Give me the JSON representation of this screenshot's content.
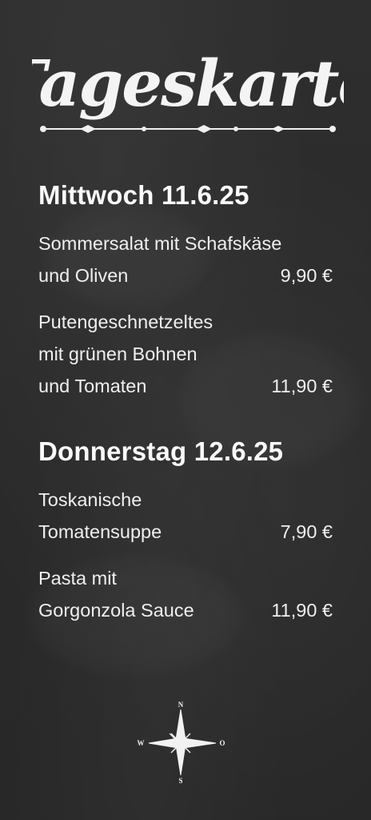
{
  "board": {
    "title": "Tageskarte"
  },
  "days": [
    {
      "heading": "Mittwoch 11.6.25",
      "items": [
        {
          "lines": [
            "Sommersalat mit Schafskäse",
            "und Oliven"
          ],
          "price": "9,90 €"
        },
        {
          "lines": [
            "Putengeschnetzeltes",
            "mit grünen Bohnen",
            "und Tomaten"
          ],
          "price": "11,90 €"
        }
      ]
    },
    {
      "heading": "Donnerstag 12.6.25",
      "items": [
        {
          "lines": [
            "Toskanische",
            "Tomatensuppe"
          ],
          "price": "7,90 €"
        },
        {
          "lines": [
            "Pasta mit",
            "Gorgonzola Sauce"
          ],
          "price": "11,90 €"
        }
      ]
    }
  ],
  "compass": {
    "icon": "compass-rose-icon",
    "north": "N",
    "west": "W",
    "east": "O",
    "south": "S"
  },
  "colors": {
    "chalkboard": "#2b2b2b",
    "chalk": "#f2f2f2"
  }
}
